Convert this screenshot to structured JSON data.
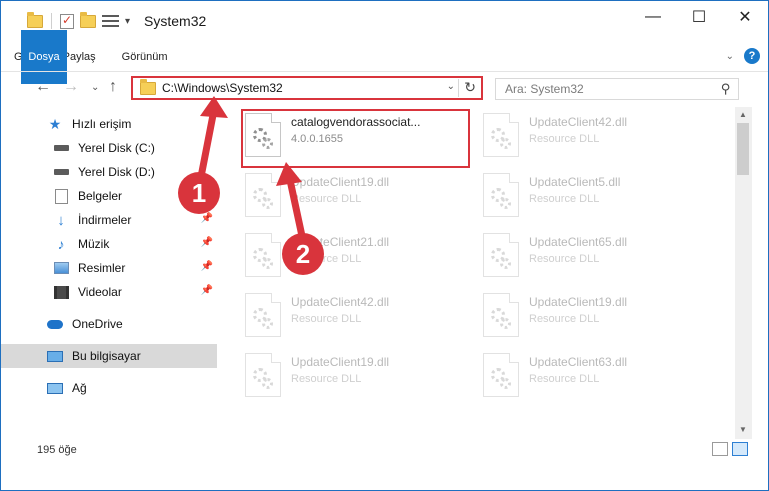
{
  "window": {
    "title": "System32",
    "controls": {
      "minimize": "—",
      "maximize": "☐",
      "close": "✕"
    }
  },
  "ribbon": {
    "tabs": [
      "Dosya",
      "Giriş",
      "Paylaş",
      "Görünüm"
    ],
    "help_label": "?"
  },
  "address": {
    "path": "C:\\Windows\\System32",
    "search_placeholder": "Ara: System32"
  },
  "sidebar": {
    "items": [
      {
        "label": "Hızlı erişim",
        "icon": "star-icon"
      },
      {
        "label": "Yerel Disk (C:)",
        "icon": "drive-icon"
      },
      {
        "label": "Yerel Disk (D:)",
        "icon": "drive-icon"
      },
      {
        "label": "Belgeler",
        "icon": "document-icon"
      },
      {
        "label": "İndirmeler",
        "icon": "download-icon"
      },
      {
        "label": "Müzik",
        "icon": "music-icon"
      },
      {
        "label": "Resimler",
        "icon": "pictures-icon"
      },
      {
        "label": "Videolar",
        "icon": "video-icon"
      },
      {
        "label": "OneDrive",
        "icon": "cloud-icon"
      },
      {
        "label": "Bu bilgisayar",
        "icon": "computer-icon"
      },
      {
        "label": "Ağ",
        "icon": "network-icon"
      }
    ]
  },
  "files": [
    {
      "name": "catalogvendorassociat...",
      "sub": "4.0.0.1655"
    },
    {
      "name": "UpdateClient42.dll",
      "sub": "Resource DLL"
    },
    {
      "name": "UpdateClient19.dll",
      "sub": "Resource DLL"
    },
    {
      "name": "UpdateClient5.dll",
      "sub": "Resource DLL"
    },
    {
      "name": "UpdateClient21.dll",
      "sub": "Resource DLL"
    },
    {
      "name": "UpdateClient65.dll",
      "sub": "Resource DLL"
    },
    {
      "name": "UpdateClient42.dll",
      "sub": "Resource DLL"
    },
    {
      "name": "UpdateClient19.dll",
      "sub": "Resource DLL"
    },
    {
      "name": "UpdateClient19.dll",
      "sub": "Resource DLL"
    },
    {
      "name": "UpdateClient63.dll",
      "sub": "Resource DLL"
    }
  ],
  "status": {
    "item_count": "195 öğe"
  },
  "annotations": {
    "badge1": "1",
    "badge2": "2"
  },
  "colors": {
    "accent": "#1979ca",
    "highlight": "#d9343c",
    "selection": "#d9d9d9"
  }
}
